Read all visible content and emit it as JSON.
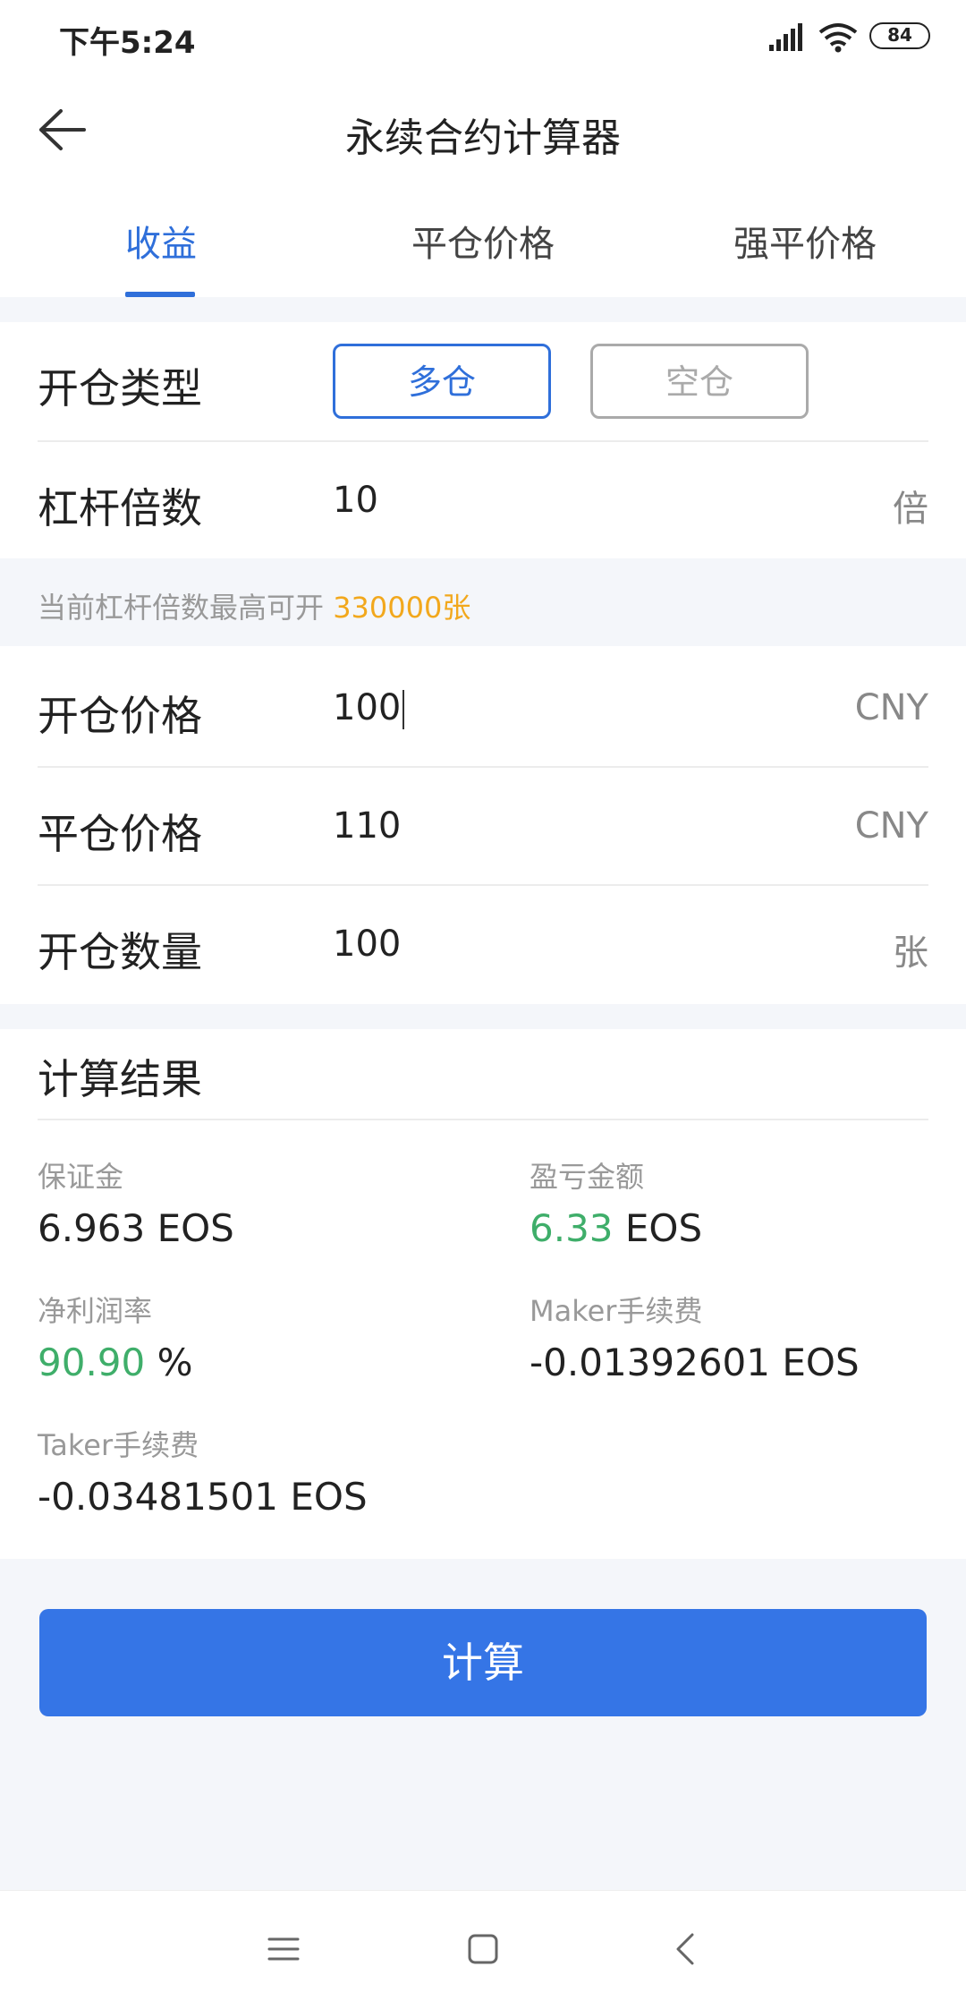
{
  "status": {
    "time": "下午5:24",
    "battery": "84"
  },
  "header": {
    "title": "永续合约计算器"
  },
  "tabs": [
    {
      "label": "收益",
      "active": true
    },
    {
      "label": "平仓价格",
      "active": false
    },
    {
      "label": "强平价格",
      "active": false
    }
  ],
  "form": {
    "position_type": {
      "label": "开仓类型",
      "long": "多仓",
      "short": "空仓",
      "selected": "多仓"
    },
    "leverage": {
      "label": "杠杆倍数",
      "value": "10",
      "unit": "倍"
    },
    "hint": {
      "text": "当前杠杆倍数最高可开",
      "value": "330000张"
    },
    "open_price": {
      "label": "开仓价格",
      "value": "100",
      "unit": "CNY"
    },
    "close_price": {
      "label": "平仓价格",
      "value": "110",
      "unit": "CNY"
    },
    "quantity": {
      "label": "开仓数量",
      "value": "100",
      "unit": "张"
    }
  },
  "results": {
    "title": "计算结果",
    "margin": {
      "label": "保证金",
      "value": "6.963 EOS"
    },
    "pnl": {
      "label": "盈亏金额",
      "value": "6.33",
      "unit": "EOS"
    },
    "net_rate": {
      "label": "净利润率",
      "value": "90.90",
      "unit": "%"
    },
    "maker_fee": {
      "label": "Maker手续费",
      "value": "-0.01392601 EOS"
    },
    "taker_fee": {
      "label": "Taker手续费",
      "value": "-0.03481501 EOS"
    }
  },
  "actions": {
    "calculate": "计算"
  },
  "colors": {
    "accent": "#2f6fda",
    "button": "#3575e6",
    "profit": "#3fae6a",
    "hint_value": "#f2a81d"
  }
}
